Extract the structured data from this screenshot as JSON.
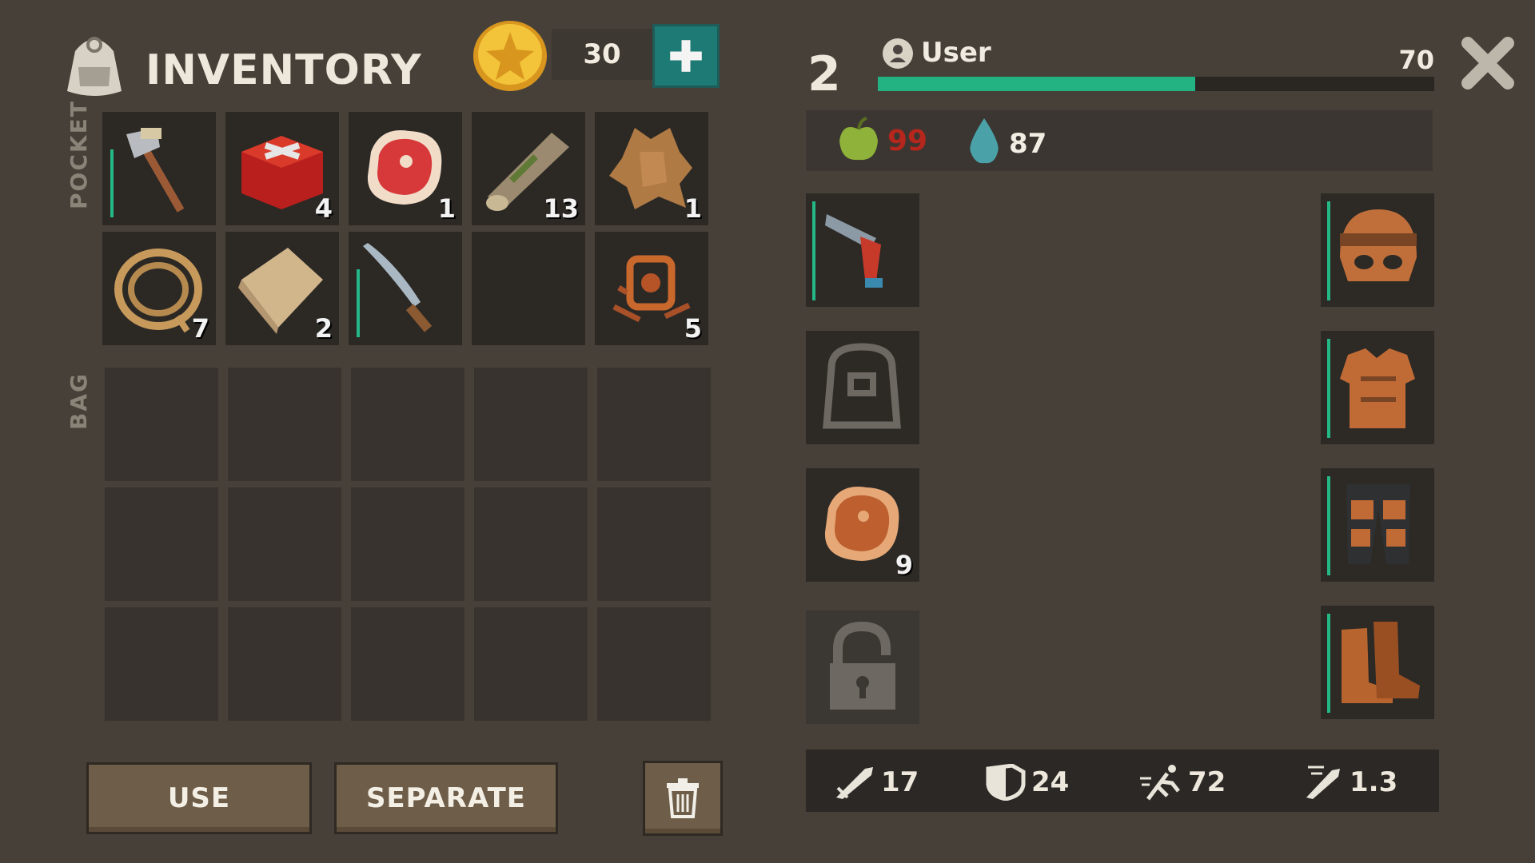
{
  "header": {
    "title": "INVENTORY",
    "coins": "30"
  },
  "sections": {
    "pocket_label": "POCKET",
    "bag_label": "BAG"
  },
  "pocket": [
    {
      "name": "hatchet",
      "count": ""
    },
    {
      "name": "red-crate",
      "count": "4"
    },
    {
      "name": "raw-meat",
      "count": "1"
    },
    {
      "name": "log",
      "count": "13"
    },
    {
      "name": "leather-hide",
      "count": "1"
    },
    {
      "name": "rope",
      "count": "7"
    },
    {
      "name": "cloth",
      "count": "2"
    },
    {
      "name": "machete",
      "count": ""
    },
    {
      "name": "empty",
      "count": ""
    },
    {
      "name": "scrap-parts",
      "count": "5"
    }
  ],
  "buttons": {
    "use": "USE",
    "separate": "SEPARATE"
  },
  "player": {
    "level": "2",
    "name": "User",
    "xp": "70",
    "xp_fraction": 0.57
  },
  "needs": {
    "food": "99",
    "water": "87"
  },
  "equipment": {
    "food_slot_count": "9"
  },
  "stats": {
    "attack": "17",
    "defense": "24",
    "speed": "72",
    "attack_speed": "1.3"
  },
  "colors": {
    "accent": "#23b382",
    "plus_button": "#1e7a74",
    "food_value": "#b5261d"
  }
}
